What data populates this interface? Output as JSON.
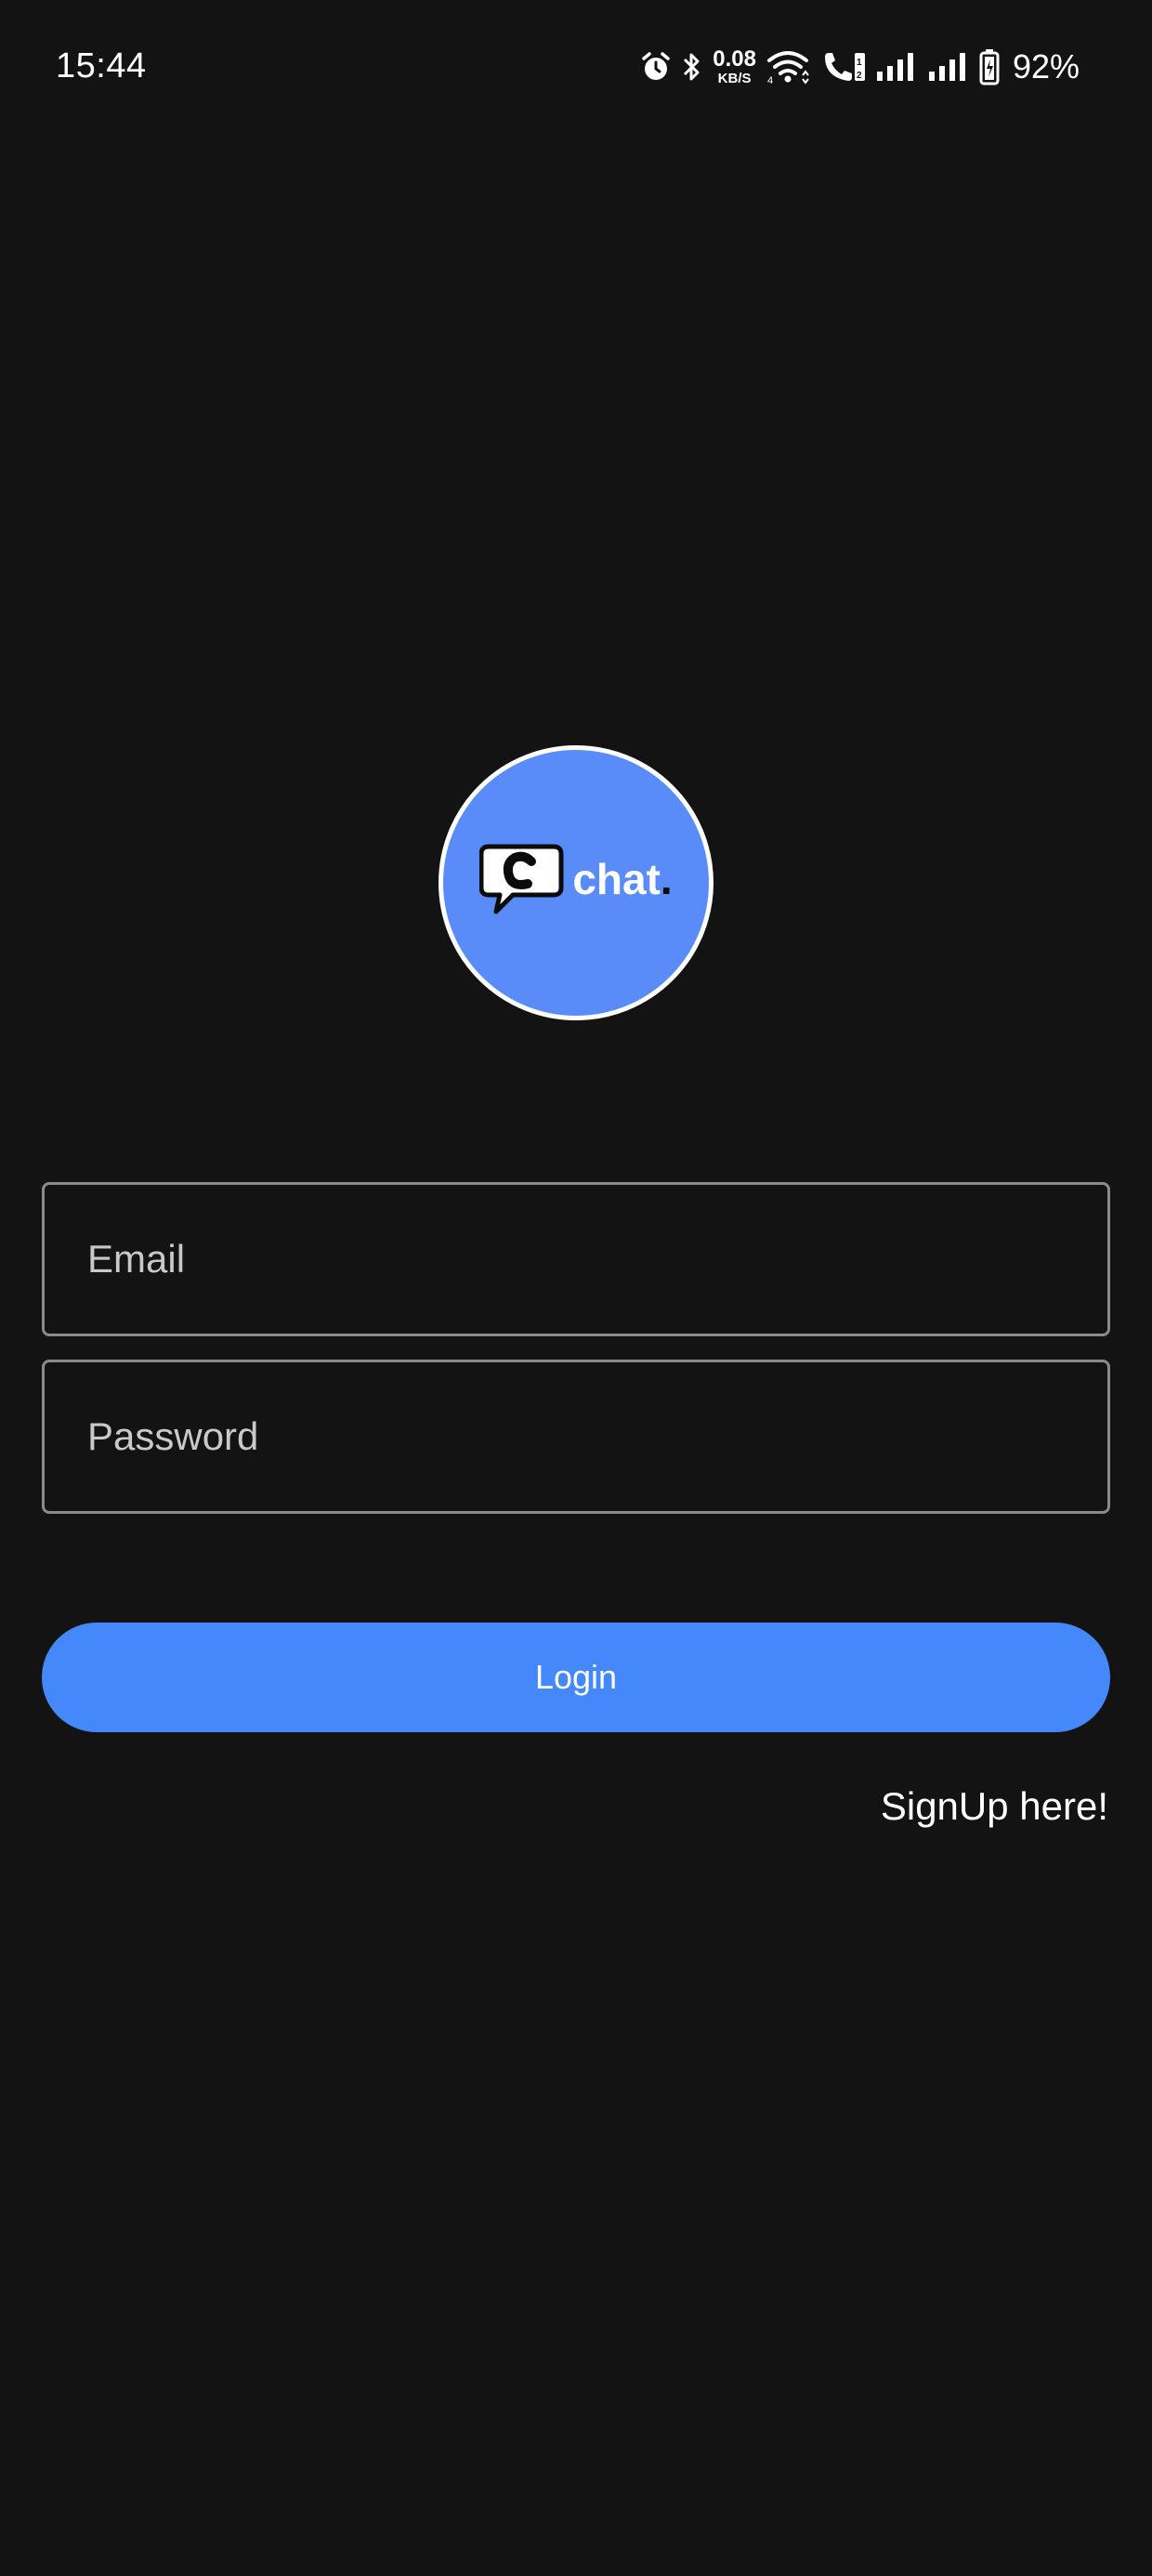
{
  "status_bar": {
    "time": "15:44",
    "net_speed_value": "0.08",
    "net_speed_unit": "KB/S",
    "battery_percent": "92%",
    "icons": [
      "alarm-icon",
      "bluetooth-icon",
      "wifi-icon",
      "volte-call-icon",
      "signal-icon",
      "signal-icon",
      "battery-icon"
    ]
  },
  "logo": {
    "text": "chat",
    "dot": ".",
    "colors": {
      "circle": "#5a8cf9",
      "border": "#ffffff"
    }
  },
  "form": {
    "email_placeholder": "Email",
    "email_value": "",
    "password_placeholder": "Password",
    "password_value": "",
    "login_label": "Login",
    "signup_label": "SignUp here!"
  },
  "colors": {
    "background": "#131313",
    "accent": "#4488fb",
    "field_border": "#8a8a8a"
  }
}
